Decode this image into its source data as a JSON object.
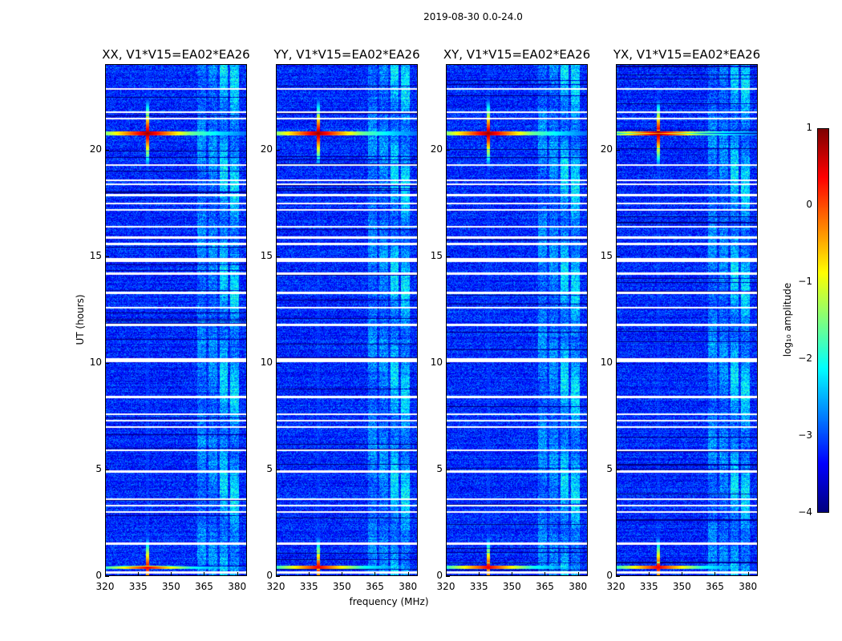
{
  "chart_data": {
    "type": "heatmap",
    "title": "2019-08-30 0.0-24.0",
    "xlabel": "frequency (MHz)",
    "ylabel": "UT (hours)",
    "xlim": [
      320,
      384.5
    ],
    "ylim": [
      0,
      24
    ],
    "xticks": [
      "320",
      "335",
      "350",
      "365",
      "380"
    ],
    "xtick_values": [
      320,
      335,
      350,
      365,
      380
    ],
    "yticks": [
      "0",
      "5",
      "10",
      "15",
      "20"
    ],
    "ytick_values": [
      0,
      5,
      10,
      15,
      20
    ],
    "panels": [
      {
        "title": "XX, V1*V15=EA02*EA26"
      },
      {
        "title": "YY, V1*V15=EA02*EA26"
      },
      {
        "title": "XY, V1*V15=EA02*EA26"
      },
      {
        "title": "YX, V1*V15=EA02*EA26"
      }
    ],
    "background_log_amplitude": -3.2,
    "rfi_features": [
      {
        "freq_mhz": 339,
        "ut_hours": 20.8,
        "peak_log_amplitude": 0.9
      },
      {
        "freq_mhz": 339,
        "ut_hours": 0.4,
        "peak_log_amplitude": 0.5
      }
    ],
    "bright_bands_mhz": [
      [
        362,
        366
      ],
      [
        367,
        371
      ],
      [
        372,
        376
      ],
      [
        377,
        381
      ]
    ],
    "flagged_ut_hours": [
      22.9,
      21.8,
      21.5,
      19.3,
      18.6,
      18.4,
      17.9,
      17.5,
      17.2,
      16.4,
      15.9,
      15.6,
      14.9,
      14.8,
      14.2,
      13.3,
      12.6,
      11.8,
      10.2,
      10.1,
      8.4,
      7.6,
      7.3,
      7.0,
      5.9,
      4.9,
      3.6,
      3.3,
      3.0,
      1.5,
      0.15
    ],
    "colorbar": {
      "label": "log₁₀ amplitude",
      "range": [
        -4,
        1
      ],
      "ticks": [
        "1",
        "0",
        "−1",
        "−2",
        "−3",
        "−4"
      ],
      "tick_values": [
        1,
        0,
        -1,
        -2,
        -3,
        -4
      ],
      "colormap": "jet"
    }
  }
}
